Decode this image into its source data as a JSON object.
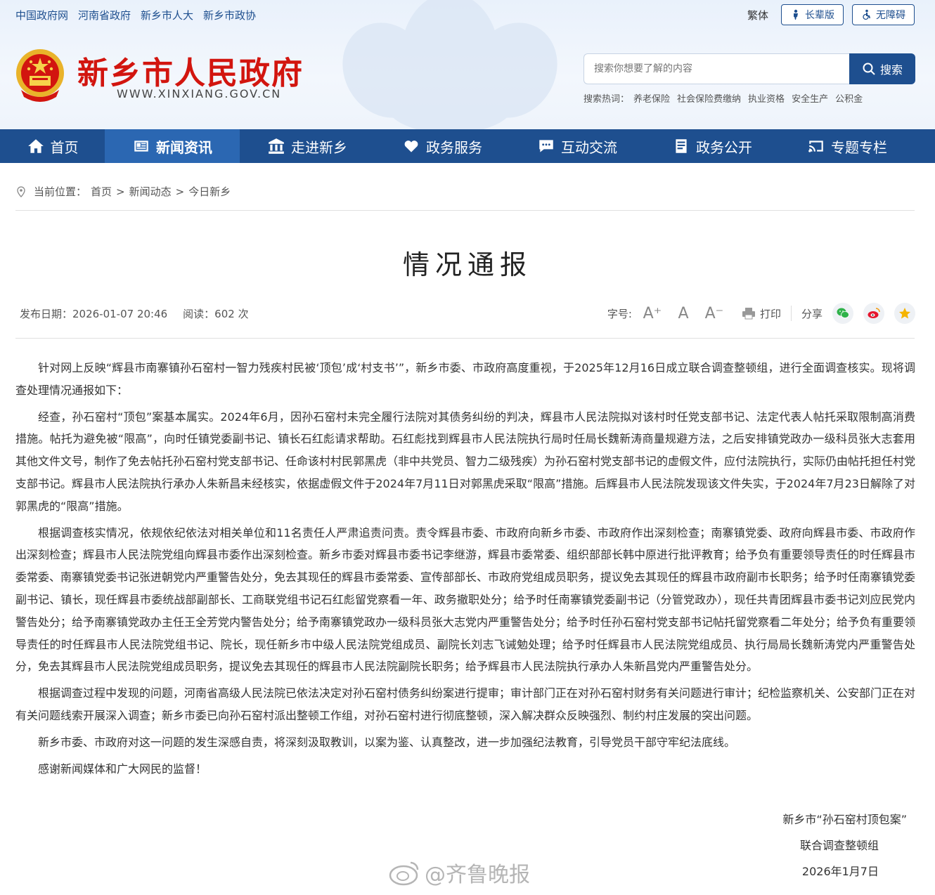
{
  "top_links": [
    "中国政府网",
    "河南省政府",
    "新乡市人大",
    "新乡市政协"
  ],
  "top_right": {
    "traditional": "繁体",
    "elder": "长辈版",
    "accessible": "无障碍"
  },
  "site": {
    "title": "新乡市人民政府",
    "domain": "WWW.XINXIANG.GOV.CN"
  },
  "search": {
    "placeholder": "搜索你想要了解的内容",
    "button": "搜索"
  },
  "hot_search": {
    "label": "搜索热词：",
    "keywords": [
      "养老保险",
      "社会保险费缴纳",
      "执业资格",
      "安全生产",
      "公积金"
    ]
  },
  "nav": [
    {
      "label": "首页",
      "icon": "home-icon"
    },
    {
      "label": "新闻资讯",
      "icon": "news-icon",
      "active": true
    },
    {
      "label": "走进新乡",
      "icon": "building-icon"
    },
    {
      "label": "政务服务",
      "icon": "heart-hand-icon"
    },
    {
      "label": "互动交流",
      "icon": "chat-icon"
    },
    {
      "label": "政务公开",
      "icon": "document-icon"
    },
    {
      "label": "专题专栏",
      "icon": "broadcast-icon"
    }
  ],
  "breadcrumb": {
    "prefix": "当前位置：",
    "items": [
      "首页",
      "新闻动态",
      "今日新乡"
    ],
    "sep": ">"
  },
  "article": {
    "title": "情况通报",
    "date_label": "发布日期：2026-01-07 20:46",
    "views_label": "阅读：602 次",
    "font_label": "字号:",
    "font_sizes": [
      "A⁺",
      "A",
      "A⁻"
    ],
    "print": "打印",
    "share": "分享",
    "paragraphs": [
      "针对网上反映“辉县市南寨镇孙石窑村一智力残疾村民被‘顶包’成‘村支书’”，新乡市委、市政府高度重视，于2025年12月16日成立联合调查整顿组，进行全面调查核实。现将调查处理情况通报如下：",
      "经查，孙石窑村“顶包”案基本属实。2024年6月，因孙石窑村未完全履行法院对其债务纠纷的判决，辉县市人民法院拟对该村时任党支部书记、法定代表人帖托采取限制高消费措施。帖托为避免被“限高”，向时任镇党委副书记、镇长石红彪请求帮助。石红彪找到辉县市人民法院执行局时任局长魏新涛商量规避方法，之后安排镇党政办一级科员张大志套用其他文件文号，制作了免去帖托孙石窑村党支部书记、任命该村村民郭黑虎（非中共党员、智力二级残疾）为孙石窑村党支部书记的虚假文件，应付法院执行，实际仍由帖托担任村党支部书记。辉县市人民法院执行承办人朱新昌未经核实，依据虚假文件于2024年7月11日对郭黑虎采取“限高”措施。后辉县市人民法院发现该文件失实，于2024年7月23日解除了对郭黑虎的“限高”措施。",
      "根据调查核实情况，依规依纪依法对相关单位和11名责任人严肃追责问责。责令辉县市委、市政府向新乡市委、市政府作出深刻检查；南寨镇党委、政府向辉县市委、市政府作出深刻检查；辉县市人民法院党组向辉县市委作出深刻检查。新乡市委对辉县市委书记李继游，辉县市委常委、组织部部长韩中原进行批评教育；给予负有重要领导责任的时任辉县市委常委、南寨镇党委书记张进朝党内严重警告处分，免去其现任的辉县市委常委、宣传部部长、市政府党组成员职务，提议免去其现任的辉县市政府副市长职务；给予时任南寨镇党委副书记、镇长，现任辉县市委统战部副部长、工商联党组书记石红彪留党察看一年、政务撤职处分；给予时任南寨镇党委副书记（分管党政办），现任共青团辉县市委书记刘应民党内警告处分；给予南寨镇党政办主任王全芳党内警告处分；给予南寨镇党政办一级科员张大志党内严重警告处分；给予时任孙石窑村党支部书记帖托留党察看二年处分；给予负有重要领导责任的时任辉县市人民法院党组书记、院长，现任新乡市中级人民法院党组成员、副院长刘志飞诫勉处理；给予时任辉县市人民法院党组成员、执行局局长魏新涛党内严重警告处分，免去其辉县市人民法院党组成员职务，提议免去其现任的辉县市人民法院副院长职务；给予辉县市人民法院执行承办人朱新昌党内严重警告处分。",
      "根据调查过程中发现的问题，河南省高级人民法院已依法决定对孙石窑村债务纠纷案进行提审；审计部门正在对孙石窑村财务有关问题进行审计；纪检监察机关、公安部门正在对有关问题线索开展深入调查；新乡市委已向孙石窑村派出整顿工作组，对孙石窑村进行彻底整顿，深入解决群众反映强烈、制约村庄发展的突出问题。",
      "新乡市委、市政府对这一问题的发生深感自责，将深刻汲取教训，以案为鉴、认真整改，进一步加强纪法教育，引导党员干部守牢纪法底线。",
      "感谢新闻媒体和广大网民的监督！"
    ],
    "signature": [
      "新乡市“孙石窑村顶包案”",
      "联合调查整顿组",
      "2026年1月7日"
    ]
  },
  "watermark": "@齐鲁晚报",
  "colors": {
    "brand_blue": "#1e4f8f",
    "nav_active": "#2b67b2",
    "title_red": "#d2150f"
  }
}
